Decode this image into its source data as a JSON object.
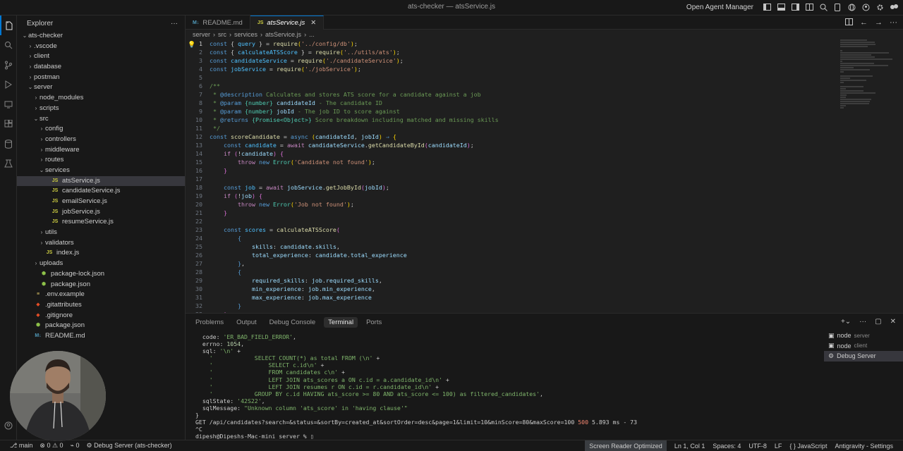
{
  "window": {
    "title": "ats-checker — atsService.js",
    "agent_manager": "Open Agent Manager"
  },
  "sidebar": {
    "title": "Explorer",
    "more": "···",
    "tree": [
      {
        "label": "ats-checker",
        "depth": 0,
        "type": "folder-open"
      },
      {
        "label": ".vscode",
        "depth": 1,
        "type": "folder"
      },
      {
        "label": "client",
        "depth": 1,
        "type": "folder"
      },
      {
        "label": "database",
        "depth": 1,
        "type": "folder"
      },
      {
        "label": "postman",
        "depth": 1,
        "type": "folder"
      },
      {
        "label": "server",
        "depth": 1,
        "type": "folder-open"
      },
      {
        "label": "node_modules",
        "depth": 2,
        "type": "folder"
      },
      {
        "label": "scripts",
        "depth": 2,
        "type": "folder"
      },
      {
        "label": "src",
        "depth": 2,
        "type": "folder-open"
      },
      {
        "label": "config",
        "depth": 3,
        "type": "folder"
      },
      {
        "label": "controllers",
        "depth": 3,
        "type": "folder"
      },
      {
        "label": "middleware",
        "depth": 3,
        "type": "folder"
      },
      {
        "label": "routes",
        "depth": 3,
        "type": "folder"
      },
      {
        "label": "services",
        "depth": 3,
        "type": "folder-open"
      },
      {
        "label": "atsService.js",
        "depth": 4,
        "type": "js",
        "selected": true
      },
      {
        "label": "candidateService.js",
        "depth": 4,
        "type": "js"
      },
      {
        "label": "emailService.js",
        "depth": 4,
        "type": "js"
      },
      {
        "label": "jobService.js",
        "depth": 4,
        "type": "js"
      },
      {
        "label": "resumeService.js",
        "depth": 4,
        "type": "js"
      },
      {
        "label": "utils",
        "depth": 3,
        "type": "folder"
      },
      {
        "label": "validators",
        "depth": 3,
        "type": "folder"
      },
      {
        "label": "index.js",
        "depth": 3,
        "type": "js"
      },
      {
        "label": "uploads",
        "depth": 2,
        "type": "folder"
      },
      {
        "label": "package-lock.json",
        "depth": 2,
        "type": "npm"
      },
      {
        "label": "package.json",
        "depth": 2,
        "type": "npm"
      },
      {
        "label": ".env.example",
        "depth": 1,
        "type": "env"
      },
      {
        "label": ".gitattributes",
        "depth": 1,
        "type": "git"
      },
      {
        "label": ".gitignore",
        "depth": 1,
        "type": "git"
      },
      {
        "label": "package.json",
        "depth": 1,
        "type": "npm"
      },
      {
        "label": "README.md",
        "depth": 1,
        "type": "md"
      }
    ]
  },
  "editor": {
    "tabs": [
      {
        "label": "README.md",
        "icon": "M↓",
        "active": false
      },
      {
        "label": "atsService.js",
        "icon": "JS",
        "active": true
      }
    ],
    "breadcrumb": [
      "server",
      "src",
      "services",
      "atsService.js",
      "..."
    ],
    "lines": [
      [
        [
          "kw",
          "const "
        ],
        [
          "tk",
          "{ "
        ],
        [
          "cn",
          "query"
        ],
        [
          "tk",
          " } = "
        ],
        [
          "fn",
          "require"
        ],
        [
          "pn",
          "("
        ],
        [
          "st",
          "'../config/db'"
        ],
        [
          "pn",
          ")"
        ],
        [
          "tk",
          ";"
        ]
      ],
      [
        [
          "kw",
          "const "
        ],
        [
          "tk",
          "{ "
        ],
        [
          "cn",
          "calculateATSScore"
        ],
        [
          "tk",
          " } = "
        ],
        [
          "fn",
          "require"
        ],
        [
          "pn",
          "("
        ],
        [
          "st",
          "'../utils/ats'"
        ],
        [
          "pn",
          ")"
        ],
        [
          "tk",
          ";"
        ]
      ],
      [
        [
          "kw",
          "const "
        ],
        [
          "cn",
          "candidateService"
        ],
        [
          "tk",
          " = "
        ],
        [
          "fn",
          "require"
        ],
        [
          "pn",
          "("
        ],
        [
          "st",
          "'./candidateService'"
        ],
        [
          "pn",
          ")"
        ],
        [
          "tk",
          ";"
        ]
      ],
      [
        [
          "kw",
          "const "
        ],
        [
          "cn",
          "jobService"
        ],
        [
          "tk",
          " = "
        ],
        [
          "fn",
          "require"
        ],
        [
          "pn",
          "("
        ],
        [
          "st",
          "'./jobService'"
        ],
        [
          "pn",
          ")"
        ],
        [
          "tk",
          ";"
        ]
      ],
      [],
      [
        [
          "cm",
          "/**"
        ]
      ],
      [
        [
          "cm",
          " * "
        ],
        [
          "kw",
          "@description"
        ],
        [
          "cm",
          " Calculates and stores ATS score for a candidate against a job"
        ]
      ],
      [
        [
          "cm",
          " * "
        ],
        [
          "kw",
          "@param"
        ],
        [
          "cm",
          " "
        ],
        [
          "ty",
          "{number}"
        ],
        [
          "cm",
          " "
        ],
        [
          "va",
          "candidateId"
        ],
        [
          "cm",
          " - The candidate ID"
        ]
      ],
      [
        [
          "cm",
          " * "
        ],
        [
          "kw",
          "@param"
        ],
        [
          "cm",
          " "
        ],
        [
          "ty",
          "{number}"
        ],
        [
          "cm",
          " "
        ],
        [
          "va",
          "jobId"
        ],
        [
          "cm",
          " - The job ID to score against"
        ]
      ],
      [
        [
          "cm",
          " * "
        ],
        [
          "kw",
          "@returns"
        ],
        [
          "cm",
          " "
        ],
        [
          "ty",
          "{Promise<Object>}"
        ],
        [
          "cm",
          " Score breakdown including matched and missing skills"
        ]
      ],
      [
        [
          "cm",
          " */"
        ]
      ],
      [
        [
          "kw",
          "const "
        ],
        [
          "fn",
          "scoreCandidate"
        ],
        [
          "tk",
          " = "
        ],
        [
          "kw",
          "async "
        ],
        [
          "pn",
          "("
        ],
        [
          "va",
          "candidateId"
        ],
        [
          "tk",
          ", "
        ],
        [
          "va",
          "jobId"
        ],
        [
          "pn",
          ")"
        ],
        [
          "kw",
          " ⇒ "
        ],
        [
          "pn",
          "{"
        ]
      ],
      [
        [
          "tk",
          "    "
        ],
        [
          "kw",
          "const "
        ],
        [
          "cn",
          "candidate"
        ],
        [
          "tk",
          " = "
        ],
        [
          "kw2",
          "await "
        ],
        [
          "va",
          "candidateService"
        ],
        [
          "tk",
          "."
        ],
        [
          "fn",
          "getCandidateById"
        ],
        [
          "pn2",
          "("
        ],
        [
          "va",
          "candidateId"
        ],
        [
          "pn2",
          ")"
        ],
        [
          "tk",
          ";"
        ]
      ],
      [
        [
          "tk",
          "    "
        ],
        [
          "kw2",
          "if "
        ],
        [
          "pn2",
          "("
        ],
        [
          "tk",
          "!"
        ],
        [
          "va",
          "candidate"
        ],
        [
          "pn2",
          ")"
        ],
        [
          "tk",
          " "
        ],
        [
          "pn2",
          "{"
        ]
      ],
      [
        [
          "tk",
          "        "
        ],
        [
          "kw2",
          "throw "
        ],
        [
          "kw",
          "new "
        ],
        [
          "ty",
          "Error"
        ],
        [
          "pn",
          "("
        ],
        [
          "st",
          "'Candidate not found'"
        ],
        [
          "pn",
          ")"
        ],
        [
          "tk",
          ";"
        ]
      ],
      [
        [
          "tk",
          "    "
        ],
        [
          "pn2",
          "}"
        ]
      ],
      [],
      [
        [
          "tk",
          "    "
        ],
        [
          "kw",
          "const "
        ],
        [
          "cn",
          "job"
        ],
        [
          "tk",
          " = "
        ],
        [
          "kw2",
          "await "
        ],
        [
          "va",
          "jobService"
        ],
        [
          "tk",
          "."
        ],
        [
          "fn",
          "getJobById"
        ],
        [
          "pn2",
          "("
        ],
        [
          "va",
          "jobId"
        ],
        [
          "pn2",
          ")"
        ],
        [
          "tk",
          ";"
        ]
      ],
      [
        [
          "tk",
          "    "
        ],
        [
          "kw2",
          "if "
        ],
        [
          "pn2",
          "("
        ],
        [
          "tk",
          "!"
        ],
        [
          "va",
          "job"
        ],
        [
          "pn2",
          ")"
        ],
        [
          "tk",
          " "
        ],
        [
          "pn2",
          "{"
        ]
      ],
      [
        [
          "tk",
          "        "
        ],
        [
          "kw2",
          "throw "
        ],
        [
          "kw",
          "new "
        ],
        [
          "ty",
          "Error"
        ],
        [
          "pn",
          "("
        ],
        [
          "st",
          "'Job not found'"
        ],
        [
          "pn",
          ")"
        ],
        [
          "tk",
          ";"
        ]
      ],
      [
        [
          "tk",
          "    "
        ],
        [
          "pn2",
          "}"
        ]
      ],
      [],
      [
        [
          "tk",
          "    "
        ],
        [
          "kw",
          "const "
        ],
        [
          "cn",
          "scores"
        ],
        [
          "tk",
          " = "
        ],
        [
          "fn",
          "calculateATSScore"
        ],
        [
          "pn2",
          "("
        ]
      ],
      [
        [
          "tk",
          "        "
        ],
        [
          "kw",
          "{"
        ]
      ],
      [
        [
          "tk",
          "            "
        ],
        [
          "va",
          "skills"
        ],
        [
          "tk",
          ": "
        ],
        [
          "va",
          "candidate"
        ],
        [
          "tk",
          "."
        ],
        [
          "va",
          "skills"
        ],
        [
          "tk",
          ","
        ]
      ],
      [
        [
          "tk",
          "            "
        ],
        [
          "va",
          "total_experience"
        ],
        [
          "tk",
          ": "
        ],
        [
          "va",
          "candidate"
        ],
        [
          "tk",
          "."
        ],
        [
          "va",
          "total_experience"
        ]
      ],
      [
        [
          "tk",
          "        "
        ],
        [
          "kw",
          "}"
        ],
        [
          "tk",
          ","
        ]
      ],
      [
        [
          "tk",
          "        "
        ],
        [
          "kw",
          "{"
        ]
      ],
      [
        [
          "tk",
          "            "
        ],
        [
          "va",
          "required_skills"
        ],
        [
          "tk",
          ": "
        ],
        [
          "va",
          "job"
        ],
        [
          "tk",
          "."
        ],
        [
          "va",
          "required_skills"
        ],
        [
          "tk",
          ","
        ]
      ],
      [
        [
          "tk",
          "            "
        ],
        [
          "va",
          "min_experience"
        ],
        [
          "tk",
          ": "
        ],
        [
          "va",
          "job"
        ],
        [
          "tk",
          "."
        ],
        [
          "va",
          "min_experience"
        ],
        [
          "tk",
          ","
        ]
      ],
      [
        [
          "tk",
          "            "
        ],
        [
          "va",
          "max_experience"
        ],
        [
          "tk",
          ": "
        ],
        [
          "va",
          "job"
        ],
        [
          "tk",
          "."
        ],
        [
          "va",
          "max_experience"
        ]
      ],
      [
        [
          "tk",
          "        "
        ],
        [
          "kw",
          "}"
        ]
      ],
      [
        [
          "tk",
          "    "
        ],
        [
          "pn2",
          ")"
        ],
        [
          "tk",
          ";"
        ]
      ]
    ]
  },
  "panel": {
    "tabs": [
      "Problems",
      "Output",
      "Debug Console",
      "Terminal",
      "Ports"
    ],
    "active_tab": "Terminal",
    "terminal_lines": [
      [
        [
          "tk",
          "  code: "
        ],
        [
          "ts",
          "'ER_BAD_FIELD_ERROR'"
        ],
        [
          "tk",
          ","
        ]
      ],
      [
        [
          "tk",
          "  errno: "
        ],
        [
          "tn",
          "1054"
        ],
        [
          "tk",
          ","
        ]
      ],
      [
        [
          "tk",
          "  sql: "
        ],
        [
          "ts",
          "'\\n'"
        ],
        [
          "tk",
          " +"
        ]
      ],
      [
        [
          "ts",
          "    '            SELECT COUNT(*) as total FROM (\\n'"
        ],
        [
          "tk",
          " +"
        ]
      ],
      [
        [
          "ts",
          "    '                SELECT c.id\\n'"
        ],
        [
          "tk",
          " +"
        ]
      ],
      [
        [
          "ts",
          "    '                FROM candidates c\\n'"
        ],
        [
          "tk",
          " +"
        ]
      ],
      [
        [
          "ts",
          "    '                LEFT JOIN ats_scores a ON c.id = a.candidate_id\\n'"
        ],
        [
          "tk",
          " +"
        ]
      ],
      [
        [
          "ts",
          "    '                LEFT JOIN resumes r ON c.id = r.candidate_id\\n'"
        ],
        [
          "tk",
          " +"
        ]
      ],
      [
        [
          "ts",
          "    '            GROUP BY c.id HAVING ats_score >= 80 AND ats_score <= 100) as filtered_candidates'"
        ],
        [
          "tk",
          ","
        ]
      ],
      [
        [
          "tk",
          "  sqlState: "
        ],
        [
          "ts",
          "'42S22'"
        ],
        [
          "tk",
          ","
        ]
      ],
      [
        [
          "tk",
          "  sqlMessage: "
        ],
        [
          "ts",
          "\"Unknown column 'ats_score' in 'having clause'\""
        ]
      ],
      [
        [
          "tk",
          "}"
        ]
      ],
      [
        [
          "tk",
          "GET /api/candidates?search=&status=&sortBy=created_at&sortOrder=desc&page=1&limit=10&minScore=80&maxScore=100 "
        ],
        [
          "tr",
          "500"
        ],
        [
          "tk",
          " 5.893 ms - 73"
        ]
      ],
      [
        [
          "tk",
          "^C"
        ]
      ],
      [
        [
          "tk",
          "dipesh@Dipeshs-Mac-mini server % "
        ],
        [
          "tk",
          "▯"
        ]
      ]
    ],
    "terminals": [
      {
        "name": "node",
        "sub": "server",
        "selected": false,
        "icon": "terminal-icon"
      },
      {
        "name": "node",
        "sub": "client",
        "selected": false,
        "icon": "terminal-icon"
      },
      {
        "name": "Debug Server",
        "sub": "",
        "selected": true,
        "icon": "gear-icon"
      }
    ]
  },
  "statusbar": {
    "branch": "main",
    "errors": "0",
    "warnings": "0",
    "ports": "0",
    "debug": "Debug Server (ats-checker)",
    "screen_reader": "Screen Reader Optimized",
    "position": "Ln 1, Col 1",
    "spaces": "Spaces: 4",
    "encoding": "UTF-8",
    "eol": "LF",
    "language": "JavaScript",
    "settings": "Antigravity - Settings"
  },
  "colors": {
    "accent": "#0078d4",
    "background": "#1f1f1f",
    "sidebar": "#181818"
  }
}
